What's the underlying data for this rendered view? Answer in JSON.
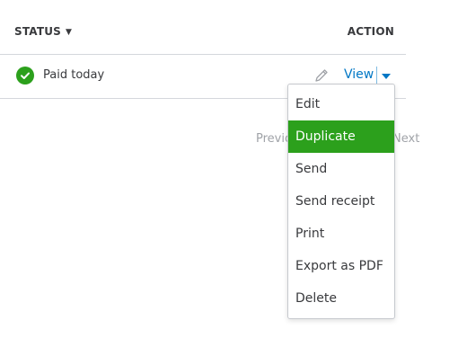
{
  "table": {
    "header": {
      "status_label": "STATUS",
      "status_sort_indicator": "▼",
      "action_label": "ACTION"
    },
    "row": {
      "status_icon": "check-circle-icon",
      "status_text": "Paid today",
      "edit_icon": "pencil-icon",
      "view_label": "View",
      "more_icon": "caret-down-icon"
    }
  },
  "pagination": {
    "previous_label": "Previous",
    "next_label": "Next"
  },
  "action_menu": {
    "items": [
      {
        "label": "Edit"
      },
      {
        "label": "Duplicate",
        "highlighted": true
      },
      {
        "label": "Send"
      },
      {
        "label": "Send receipt"
      },
      {
        "label": "Print"
      },
      {
        "label": "Export as PDF"
      },
      {
        "label": "Delete"
      }
    ]
  },
  "colors": {
    "accent_green": "#2ca01c",
    "link_blue": "#0077c5",
    "text_dark": "#393a3d",
    "text_muted": "#a0a3a8",
    "divider": "#d4d7dc"
  }
}
